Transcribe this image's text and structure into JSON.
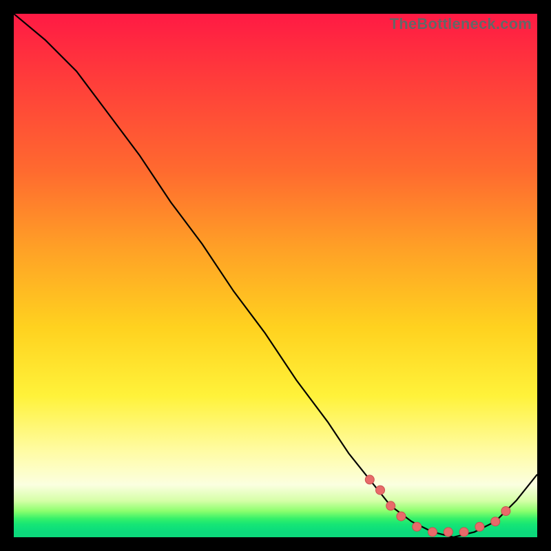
{
  "watermark": "TheBottleneck.com",
  "colors": {
    "background": "#000000",
    "curve": "#000000",
    "marker_fill": "#e86a6a",
    "marker_stroke": "#c94f4f",
    "gradient_top": "#ff1a44",
    "gradient_bottom": "#0cd97b"
  },
  "chart_data": {
    "type": "line",
    "title": "",
    "xlabel": "",
    "ylabel": "",
    "xlim": [
      0,
      100
    ],
    "ylim": [
      0,
      100
    ],
    "grid": false,
    "legend": false,
    "series": [
      {
        "name": "bottleneck-curve",
        "x": [
          0,
          6,
          12,
          18,
          24,
          30,
          36,
          42,
          48,
          54,
          60,
          64,
          68,
          72,
          76,
          80,
          84,
          88,
          92,
          96,
          100
        ],
        "y": [
          100,
          95,
          89,
          81,
          73,
          64,
          56,
          47,
          39,
          30,
          22,
          16,
          11,
          6,
          3,
          1,
          0,
          1,
          3,
          7,
          12
        ]
      }
    ],
    "markers": {
      "name": "highlight-dots",
      "x": [
        68,
        70,
        72,
        74,
        77,
        80,
        83,
        86,
        89,
        92,
        94
      ],
      "y": [
        11,
        9,
        6,
        4,
        2,
        1,
        1,
        1,
        2,
        3,
        5
      ]
    },
    "annotations": []
  }
}
